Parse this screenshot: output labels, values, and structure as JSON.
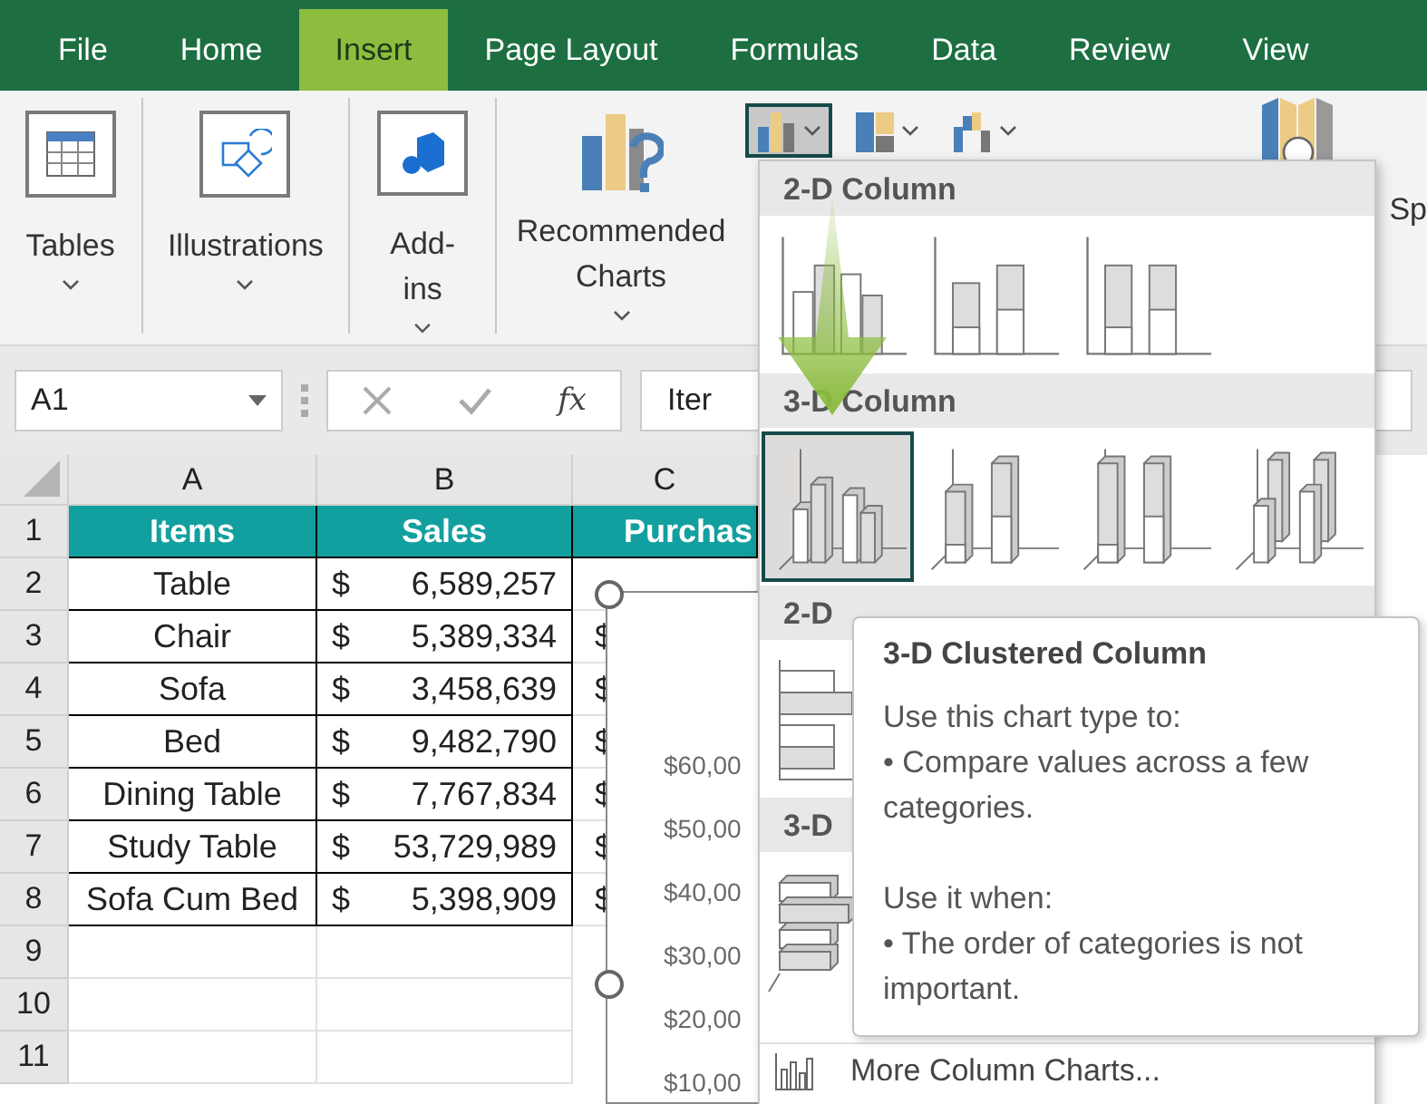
{
  "tabs": [
    {
      "label": "File",
      "selected": false
    },
    {
      "label": "Home",
      "selected": false
    },
    {
      "label": "Insert",
      "selected": true
    },
    {
      "label": "Page Layout",
      "selected": false
    },
    {
      "label": "Formulas",
      "selected": false
    },
    {
      "label": "Data",
      "selected": false
    },
    {
      "label": "Review",
      "selected": false
    },
    {
      "label": "View",
      "selected": false
    }
  ],
  "ribbon": {
    "groups": [
      {
        "label": "Tables",
        "kind": "tables"
      },
      {
        "label": "Illustrations",
        "kind": "illustrations"
      },
      {
        "label": "Add-ins",
        "kind": "addins"
      },
      {
        "label": "Recommended Charts",
        "kind": "recommended"
      }
    ],
    "chart_buttons": [
      {
        "kind": "column",
        "selected": true
      },
      {
        "kind": "hierarchy",
        "selected": false
      },
      {
        "kind": "waterfall",
        "selected": false
      }
    ],
    "cut_label": "Sp"
  },
  "formula_bar": {
    "name_box": "A1",
    "function_label": "fx",
    "value": "Iter"
  },
  "sheet": {
    "columns": [
      "A",
      "B",
      "C"
    ],
    "row_numbers": [
      "1",
      "2",
      "3",
      "4",
      "5",
      "6",
      "7",
      "8",
      "9",
      "10",
      "11"
    ],
    "header": {
      "items": "Items",
      "sales": "Sales",
      "column_c": "Purchas"
    },
    "rows": [
      {
        "item": "Table",
        "currency": "$",
        "sales": "6,589,257"
      },
      {
        "item": "Chair",
        "currency": "$",
        "sales": "5,389,334",
        "column_c": "$"
      },
      {
        "item": "Sofa",
        "currency": "$",
        "sales": "3,458,639",
        "column_c": "$"
      },
      {
        "item": "Bed",
        "currency": "$",
        "sales": "9,482,790",
        "column_c": "$"
      },
      {
        "item": "Dining Table",
        "currency": "$",
        "sales": "7,767,834",
        "column_c": "$"
      },
      {
        "item": "Study Table",
        "currency": "$",
        "sales": "53,729,989",
        "column_c": "$"
      },
      {
        "item": "Sofa Cum Bed",
        "currency": "$",
        "sales": "5,398,909",
        "column_c": "$"
      }
    ]
  },
  "chart_object": {
    "axis_labels": [
      "$60,00",
      "$50,00",
      "$40,00",
      "$30,00",
      "$20,00",
      "$10,00"
    ]
  },
  "gallery": {
    "sections": [
      {
        "title": "2-D Column",
        "options": [
          {
            "kind": "clustered2d",
            "selected": false
          },
          {
            "kind": "stacked2d",
            "selected": false
          },
          {
            "kind": "full2d",
            "selected": false
          }
        ]
      },
      {
        "title": "3-D Column",
        "options": [
          {
            "kind": "clustered3d",
            "selected": true
          },
          {
            "kind": "stacked3d",
            "selected": false
          },
          {
            "kind": "full3d",
            "selected": false
          },
          {
            "kind": "column3d",
            "selected": false
          }
        ]
      },
      {
        "title": "2-D",
        "options": [
          {
            "kind": "bar2d",
            "selected": false
          }
        ]
      },
      {
        "title": "3-D",
        "options": [
          {
            "kind": "bar3d",
            "selected": false
          }
        ]
      }
    ],
    "more_link": "More Column Charts..."
  },
  "tooltip": {
    "title": "3-D Clustered Column",
    "paragraphs": [
      {
        "heading": "Use this chart type to:",
        "bullet": "• Compare values across a few categories."
      },
      {
        "heading": "Use it when:",
        "bullet": "• The order of categories is not important."
      }
    ]
  }
}
